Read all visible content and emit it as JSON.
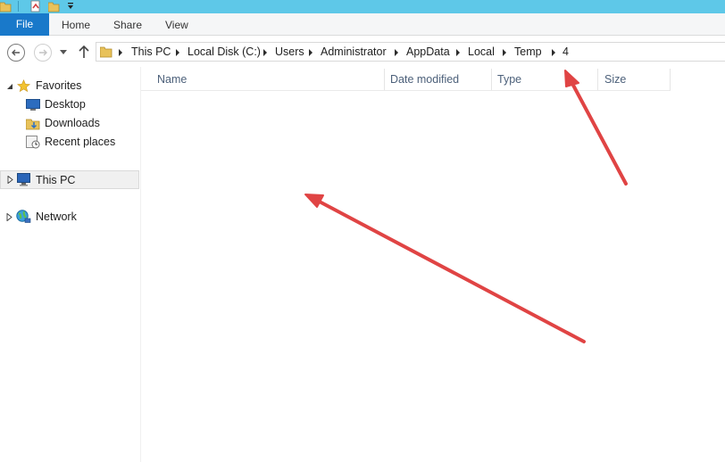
{
  "ribbon": {
    "tabs": [
      "File",
      "Home",
      "Share",
      "View"
    ],
    "file_color": "#1979ca"
  },
  "address": {
    "crumbs": [
      "This PC",
      "Local Disk (C:)",
      "Users",
      "Administrator",
      "AppData",
      "Local",
      "Temp",
      "4"
    ]
  },
  "navpane": {
    "favorites": "Favorites",
    "desktop": "Desktop",
    "downloads": "Downloads",
    "recent": "Recent places",
    "thispc": "This PC",
    "network": "Network"
  },
  "columns": {
    "name": "Name",
    "date": "Date modified",
    "type": "Type",
    "size": "Size"
  },
  "annotation_color": "#e04444"
}
